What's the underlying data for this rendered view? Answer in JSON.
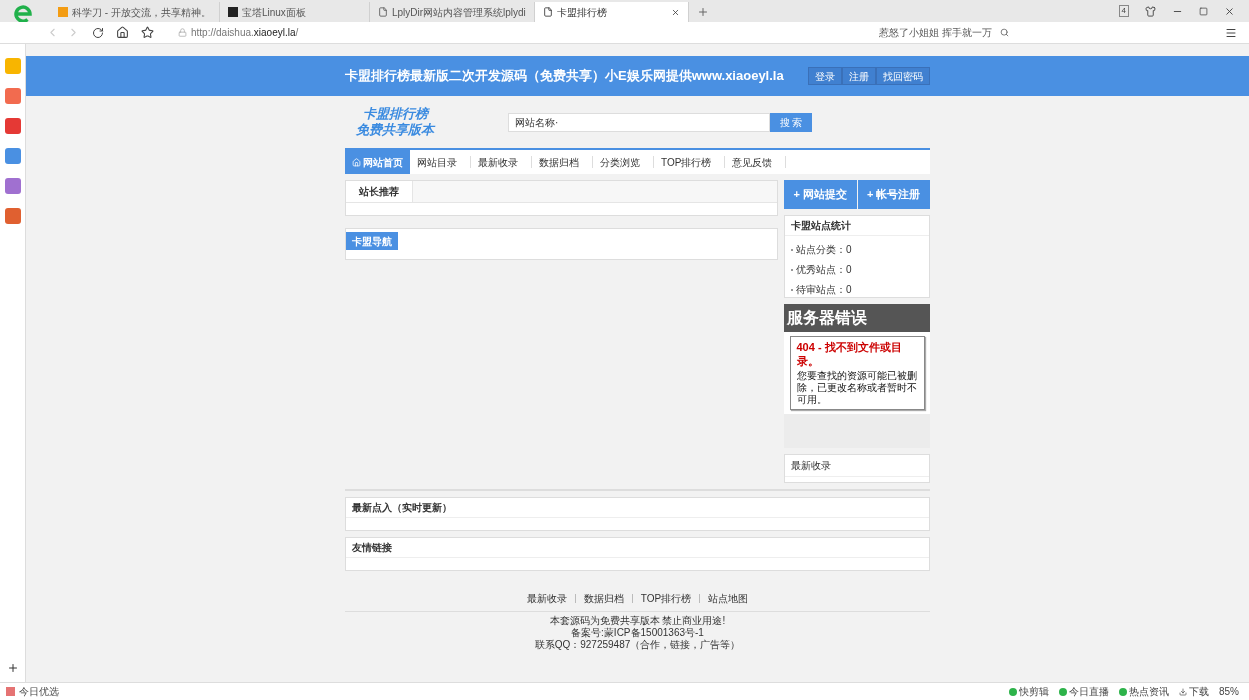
{
  "browser": {
    "tabs": [
      {
        "title": "科学刀 - 开放交流，共享精神。",
        "selected": false
      },
      {
        "title": "宝塔Linux面板",
        "selected": false
      },
      {
        "title": "LplyDir网站内容管理系统lplydi",
        "selected": false
      },
      {
        "title": "卡盟排行榜",
        "selected": true
      }
    ],
    "tab_count": "4",
    "url_prefix": "http://daishua.",
    "url_host": "xiaoeyl.la",
    "url_suffix": "/",
    "search_text": "惹怒了小姐姐 挥手就一万"
  },
  "header": {
    "title": "卡盟排行榜最新版二次开发源码（免费共享）小E娱乐网提供www.xiaoeyl.la",
    "buttons": [
      "登录",
      "注册",
      "找回密码"
    ]
  },
  "logo": {
    "line1": "卡盟排行榜",
    "line2": "免费共享版本"
  },
  "search": {
    "placeholder": "网站名称·",
    "button": "搜 索"
  },
  "nav": [
    {
      "label": "网站首页",
      "selected": true
    },
    {
      "label": "网站目录",
      "selected": false
    },
    {
      "label": "最新收录",
      "selected": false
    },
    {
      "label": "数据归档",
      "selected": false
    },
    {
      "label": "分类浏览",
      "selected": false
    },
    {
      "label": "TOP排行榜",
      "selected": false
    },
    {
      "label": "意见反馈",
      "selected": false
    }
  ],
  "recommend_tab": "站长推荐",
  "nav_panel_label": "卡盟导航",
  "action_buttons": [
    "+ 网站提交",
    "+ 帐号注册"
  ],
  "stats": {
    "title": "卡盟站点统计",
    "items": [
      "站点分类：0",
      "优秀站点：0",
      "待审站点：0"
    ]
  },
  "error": {
    "title": "服务器错误",
    "heading": "404 - 找不到文件或目录。",
    "message": "您要查找的资源可能已被删除，已更改名称或者暂时不可用。"
  },
  "latest_title": "最新收录",
  "recent_visits_title": "最新点入（实时更新）",
  "links_title": "友情链接",
  "footer": {
    "links": [
      "最新收录",
      "数据归档",
      "TOP排行榜",
      "站点地图"
    ],
    "lines": [
      "本套源码为免费共享版本 禁止商业用途!",
      "备案号:蒙ICP备15001363号-1",
      "联系QQ：927259487（合作，链接，广告等）"
    ]
  },
  "status_bar": {
    "left": "今日优选",
    "items": [
      "快剪辑",
      "今日直播",
      "热点资讯",
      "下载"
    ],
    "zoom": "85%"
  }
}
